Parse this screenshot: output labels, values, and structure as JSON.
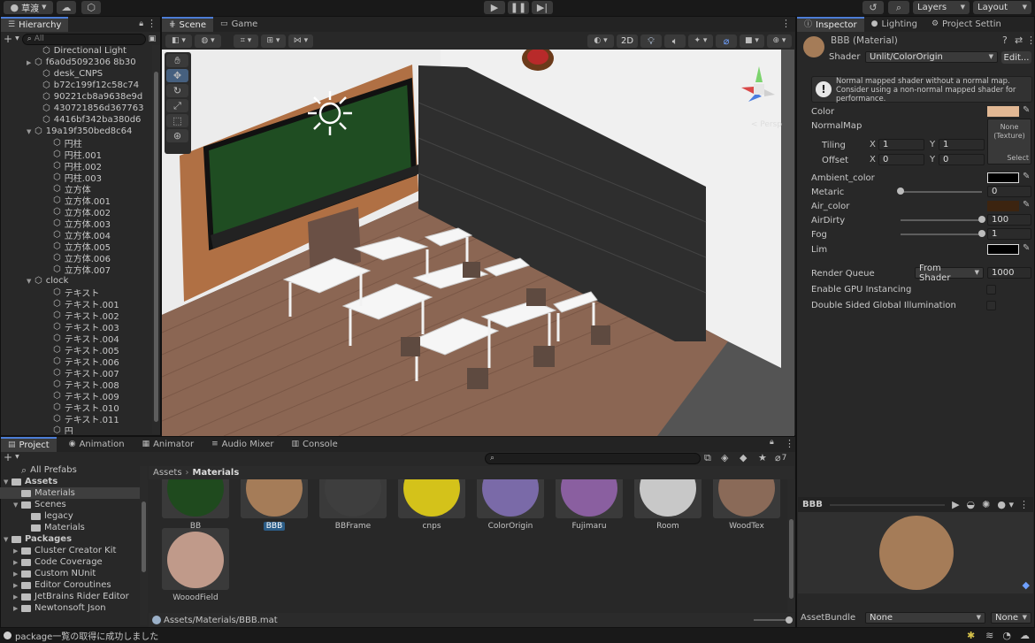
{
  "toolbar": {
    "account": "草渡",
    "layers": "Layers",
    "layout": "Layout"
  },
  "hierarchy": {
    "tab": "Hierarchy",
    "search_placeholder": "All",
    "rows": [
      {
        "label": "Directional Light",
        "indent": 1,
        "fold": ""
      },
      {
        "label": "f6a0d5092306 8b30",
        "indent": 1,
        "fold": "▶"
      },
      {
        "label": "desk_CNPS",
        "indent": 1,
        "fold": ""
      },
      {
        "label": "b72c199f12c58c74",
        "indent": 1,
        "fold": ""
      },
      {
        "label": "90221cb8a9638e9d",
        "indent": 1,
        "fold": ""
      },
      {
        "label": "430721856d367763",
        "indent": 1,
        "fold": ""
      },
      {
        "label": "4416bf342ba380d6",
        "indent": 1,
        "fold": ""
      },
      {
        "label": "19a19f350bed8c64",
        "indent": 1,
        "fold": "▼"
      },
      {
        "label": "円柱",
        "indent": 2,
        "fold": ""
      },
      {
        "label": "円柱.001",
        "indent": 2,
        "fold": ""
      },
      {
        "label": "円柱.002",
        "indent": 2,
        "fold": ""
      },
      {
        "label": "円柱.003",
        "indent": 2,
        "fold": ""
      },
      {
        "label": "立方体",
        "indent": 2,
        "fold": ""
      },
      {
        "label": "立方体.001",
        "indent": 2,
        "fold": ""
      },
      {
        "label": "立方体.002",
        "indent": 2,
        "fold": ""
      },
      {
        "label": "立方体.003",
        "indent": 2,
        "fold": ""
      },
      {
        "label": "立方体.004",
        "indent": 2,
        "fold": ""
      },
      {
        "label": "立方体.005",
        "indent": 2,
        "fold": ""
      },
      {
        "label": "立方体.006",
        "indent": 2,
        "fold": ""
      },
      {
        "label": "立方体.007",
        "indent": 2,
        "fold": ""
      },
      {
        "label": "clock",
        "indent": 1,
        "fold": "▼"
      },
      {
        "label": "テキスト",
        "indent": 2,
        "fold": ""
      },
      {
        "label": "テキスト.001",
        "indent": 2,
        "fold": ""
      },
      {
        "label": "テキスト.002",
        "indent": 2,
        "fold": ""
      },
      {
        "label": "テキスト.003",
        "indent": 2,
        "fold": ""
      },
      {
        "label": "テキスト.004",
        "indent": 2,
        "fold": ""
      },
      {
        "label": "テキスト.005",
        "indent": 2,
        "fold": ""
      },
      {
        "label": "テキスト.006",
        "indent": 2,
        "fold": ""
      },
      {
        "label": "テキスト.007",
        "indent": 2,
        "fold": ""
      },
      {
        "label": "テキスト.008",
        "indent": 2,
        "fold": ""
      },
      {
        "label": "テキスト.009",
        "indent": 2,
        "fold": ""
      },
      {
        "label": "テキスト.010",
        "indent": 2,
        "fold": ""
      },
      {
        "label": "テキスト.011",
        "indent": 2,
        "fold": ""
      },
      {
        "label": "円",
        "indent": 2,
        "fold": ""
      }
    ]
  },
  "scene": {
    "tab_scene": "Scene",
    "tab_game": "Game",
    "btn_2d": "2D",
    "gizmo_label": "< Persp"
  },
  "inspector": {
    "tab_inspector": "Inspector",
    "tab_lighting": "Lighting",
    "tab_project_settings": "Project Settin",
    "material_name": "BBB (Material)",
    "shader_label": "Shader",
    "shader_value": "Unlit/ColorOrigin",
    "edit_button": "Edit...",
    "warning": "Normal mapped shader without a normal map. Consider using a non-normal mapped shader for performance.",
    "color_label": "Color",
    "normalmap_label": "NormalMap",
    "texture_none": "None (Texture)",
    "select_label": "Select",
    "tiling_label": "Tiling",
    "offset_label": "Offset",
    "x": "X",
    "y": "Y",
    "tiling_x": "1",
    "tiling_y": "1",
    "offset_x": "0",
    "offset_y": "0",
    "ambient_color_label": "Ambient_color",
    "metaric_label": "Metaric",
    "metaric_value": "0",
    "metaric_level": 0.0,
    "air_color_label": "Air_color",
    "airdirty_label": "AirDirty",
    "airdirty_value": "100",
    "airdirty_level": 1.0,
    "fog_label": "Fog",
    "fog_value": "1",
    "fog_level": 1.0,
    "lim_label": "Lim",
    "render_queue_label": "Render Queue",
    "render_queue_mode": "From Shader",
    "render_queue_value": "1000",
    "gpu_instancing_label": "Enable GPU Instancing",
    "double_sided_label": "Double Sided Global Illumination",
    "preview_name": "BBB",
    "assetbundle_label": "AssetBundle",
    "assetbundle_value": "None",
    "assetbundle_variant": "None",
    "colors": {
      "color": "#e2b894",
      "ambient": "#000000",
      "air": "#3c2410",
      "lim": "#000000",
      "preview_sphere": "#a57c58"
    }
  },
  "project": {
    "tabs": [
      "Project",
      "Animation",
      "Animator",
      "Audio Mixer",
      "Console"
    ],
    "hidden_count": "7",
    "tree": [
      {
        "label": "All Prefabs",
        "indent": 1,
        "type": "search"
      },
      {
        "label": "Assets",
        "indent": 0,
        "type": "folder-open",
        "bold": true
      },
      {
        "label": "Materials",
        "indent": 1,
        "type": "folder",
        "selected": true
      },
      {
        "label": "Scenes",
        "indent": 1,
        "type": "folder-open"
      },
      {
        "label": "legacy",
        "indent": 2,
        "type": "folder"
      },
      {
        "label": "Materials",
        "indent": 2,
        "type": "folder"
      },
      {
        "label": "Packages",
        "indent": 0,
        "type": "folder-open",
        "bold": true
      },
      {
        "label": "Cluster Creator Kit",
        "indent": 1,
        "type": "folder"
      },
      {
        "label": "Code Coverage",
        "indent": 1,
        "type": "folder"
      },
      {
        "label": "Custom NUnit",
        "indent": 1,
        "type": "folder"
      },
      {
        "label": "Editor Coroutines",
        "indent": 1,
        "type": "folder"
      },
      {
        "label": "JetBrains Rider Editor",
        "indent": 1,
        "type": "folder"
      },
      {
        "label": "Newtonsoft Json",
        "indent": 1,
        "type": "folder"
      }
    ],
    "breadcrumb_root": "Assets",
    "breadcrumb_current": "Materials",
    "assets": [
      {
        "label": "BB",
        "color": "#1f4a1e",
        "selected": false
      },
      {
        "label": "BBB",
        "color": "#a57c58",
        "selected": true
      },
      {
        "label": "BBFrame",
        "color": "#3e3e3e",
        "selected": false
      },
      {
        "label": "cnps",
        "color": "#d4c21a",
        "selected": false
      },
      {
        "label": "ColorOrigin",
        "color": "#7a6aa8",
        "selected": false
      },
      {
        "label": "Fujimaru",
        "color": "#8a5fa0",
        "selected": false
      },
      {
        "label": "Room",
        "color": "#c8c8c8",
        "selected": false
      },
      {
        "label": "WoodTex",
        "color": "#8a6a58",
        "selected": false
      },
      {
        "label": "WooodField",
        "color": "#c09a8a",
        "selected": false
      }
    ],
    "footer_path": "Assets/Materials/BBB.mat"
  },
  "status": {
    "message": "package一覧の取得に成功しました"
  }
}
